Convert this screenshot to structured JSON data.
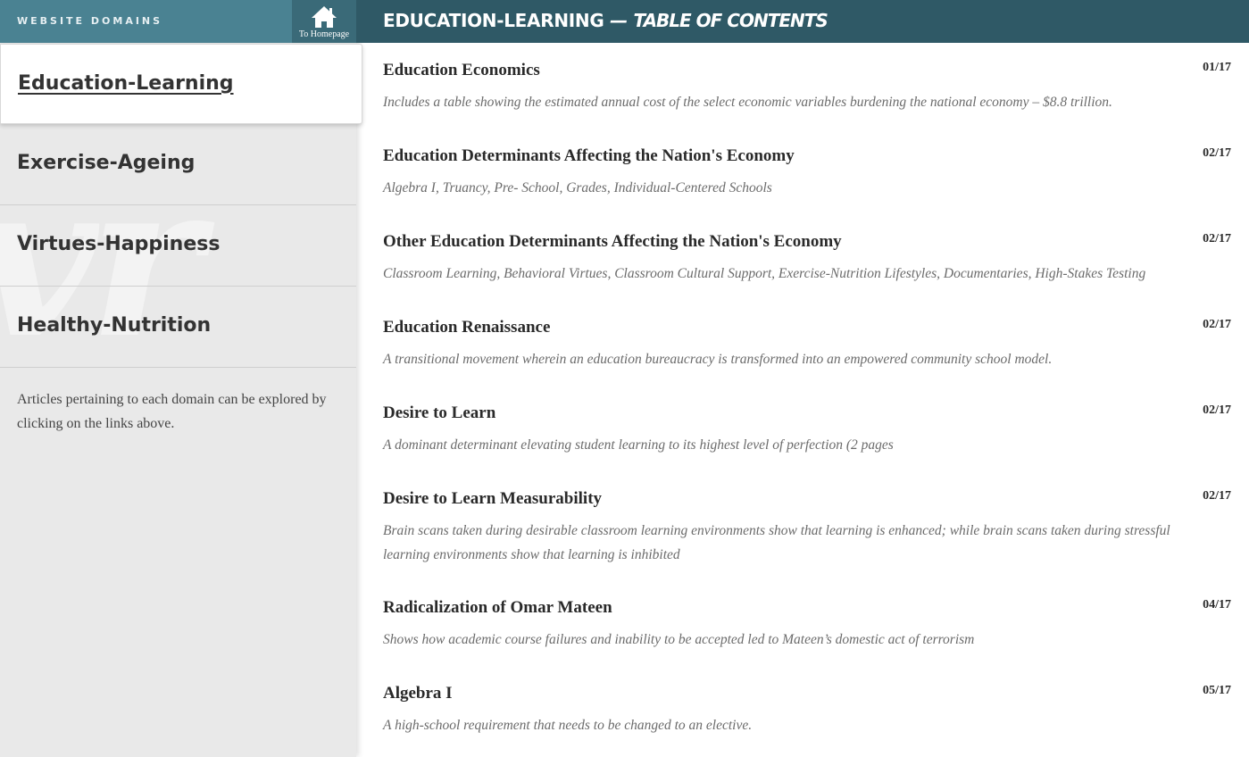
{
  "sidebar": {
    "header_label": "WEBSITE DOMAINS",
    "home_label": "To Homepage",
    "watermark": "vr",
    "domains": [
      {
        "label": "Education-Learning",
        "active": true
      },
      {
        "label": "Exercise-Ageing",
        "active": false
      },
      {
        "label": "Virtues-Happiness",
        "active": false
      },
      {
        "label": "Healthy-Nutrition",
        "active": false
      }
    ],
    "note": "Articles pertaining to each domain can be explored by clicking on the links above."
  },
  "header": {
    "domain": "EDUCATION-LEARNING",
    "dash": " — ",
    "subtitle": "TABLE OF CONTENTS"
  },
  "entries": [
    {
      "title": "Education Economics",
      "date": "01/17",
      "desc": "Includes a table showing the estimated annual cost of the select economic variables burdening the national economy – $8.8 trillion."
    },
    {
      "title": "Education Determinants Affecting the Nation's Economy",
      "date": "02/17",
      "desc": "Algebra I, Truancy, Pre- School, Grades, Individual-Centered Schools"
    },
    {
      "title": "Other Education Determinants Affecting the Nation's Economy",
      "date": "02/17",
      "desc": "Classroom Learning, Behavioral Virtues, Classroom Cultural Support, Exercise-Nutrition Lifestyles, Documentaries, High-Stakes Testing"
    },
    {
      "title": "Education Renaissance",
      "date": "02/17",
      "desc": "A transitional movement wherein an education bureaucracy is transformed into an empowered community school model."
    },
    {
      "title": "Desire to Learn",
      "date": "02/17",
      "desc": "A dominant determinant elevating student learning to its highest level of perfection (2 pages"
    },
    {
      "title": "Desire to Learn Measurability",
      "date": "02/17",
      "desc": "Brain scans taken during desirable classroom learning environments show that learning is enhanced; while brain scans taken during stressful learning environments show that learning is inhibited"
    },
    {
      "title": "Radicalization of Omar Mateen",
      "date": "04/17",
      "desc": "Shows how academic course failures and inability to be accepted led to Mateen’s domestic act of terrorism"
    },
    {
      "title": "Algebra I",
      "date": "05/17",
      "desc": "A high-school requirement that needs to be changed to an elective."
    }
  ],
  "colors": {
    "sidebar_header": "#4a8292",
    "home_button": "#3a6a78",
    "topbar": "#2f5966",
    "sidebar_bg": "#e9e9e9"
  },
  "icons": {
    "home": "home-icon"
  }
}
